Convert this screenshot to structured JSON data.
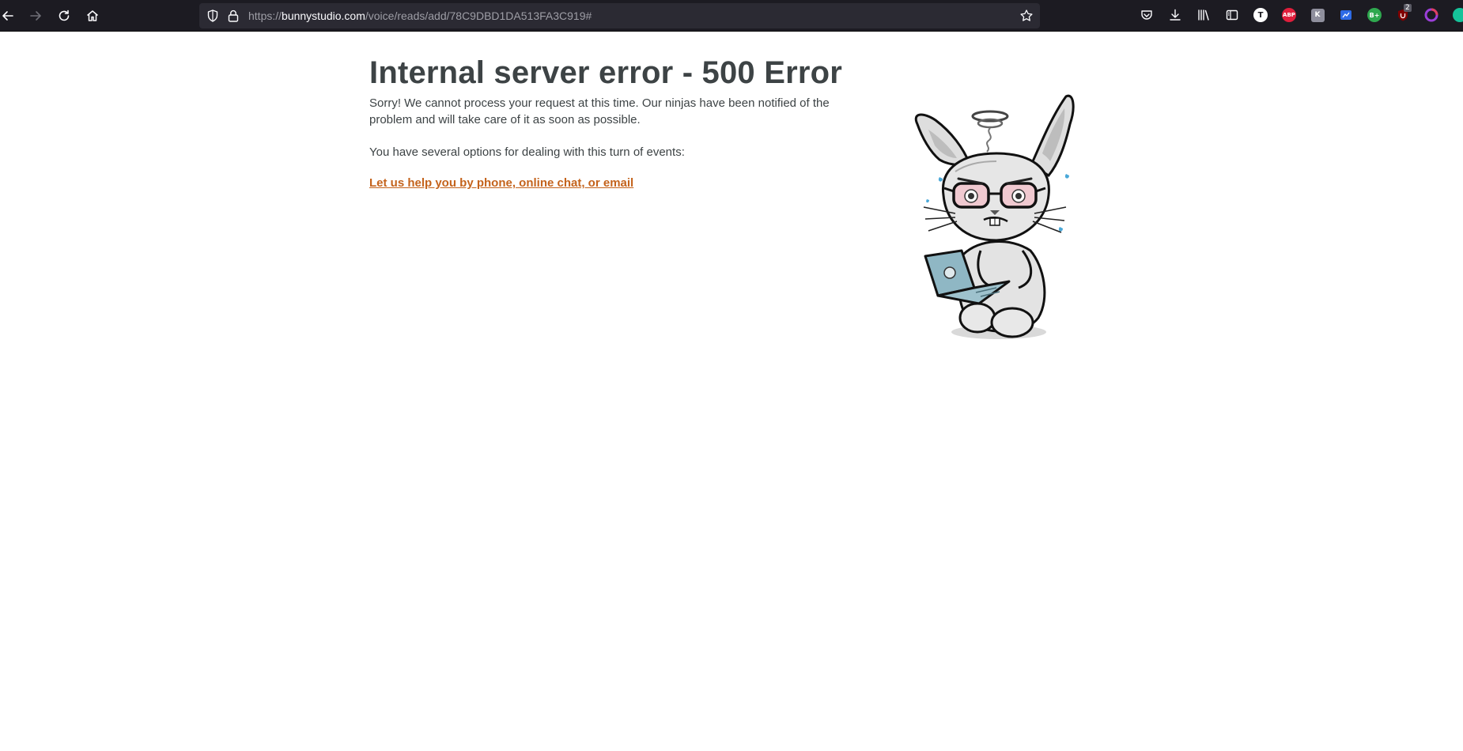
{
  "browser": {
    "url": {
      "scheme": "https://",
      "host": "bunnystudio.com",
      "path": "/voice/reads/add/78C9DBD1DA513FA3C919#"
    },
    "extensions": {
      "trello_letter": "T",
      "abp_label": "ABP",
      "k_label": "K",
      "bplus_label": "B+",
      "ublock_count": "2"
    }
  },
  "page": {
    "title": "Internal server error - 500 Error",
    "message": "Sorry! We cannot process your request at this time. Our ninjas have been notified of the problem and will take care of it as soon as possible.",
    "options_text": "You have several options for dealing with this turn of events:",
    "help_link": "Let us help you by phone, online chat, or email"
  },
  "colors": {
    "heading": "#3d4345",
    "link": "#c4631c",
    "chrome_bg": "#1c1b22",
    "urlbar_bg": "#2b2a33"
  }
}
